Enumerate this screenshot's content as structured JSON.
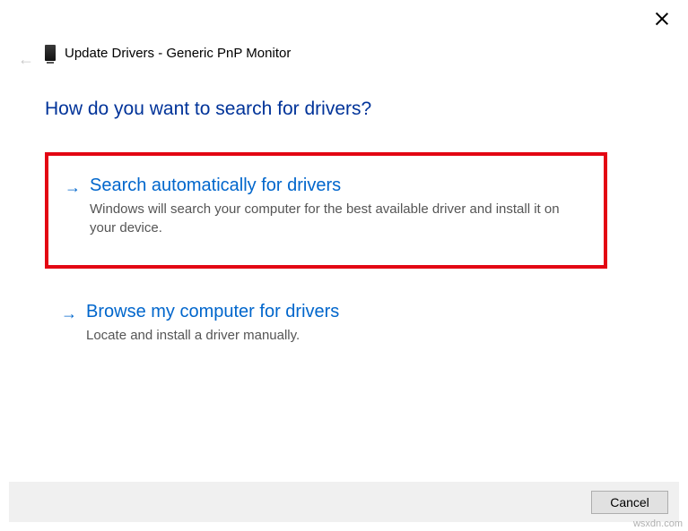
{
  "header": {
    "title": "Update Drivers - Generic PnP Monitor"
  },
  "heading": "How do you want to search for drivers?",
  "options": {
    "auto": {
      "title": "Search automatically for drivers",
      "desc": "Windows will search your computer for the best available driver and install it on your device."
    },
    "browse": {
      "title": "Browse my computer for drivers",
      "desc": "Locate and install a driver manually."
    }
  },
  "footer": {
    "cancel": "Cancel"
  },
  "watermark": "wsxdn.com"
}
